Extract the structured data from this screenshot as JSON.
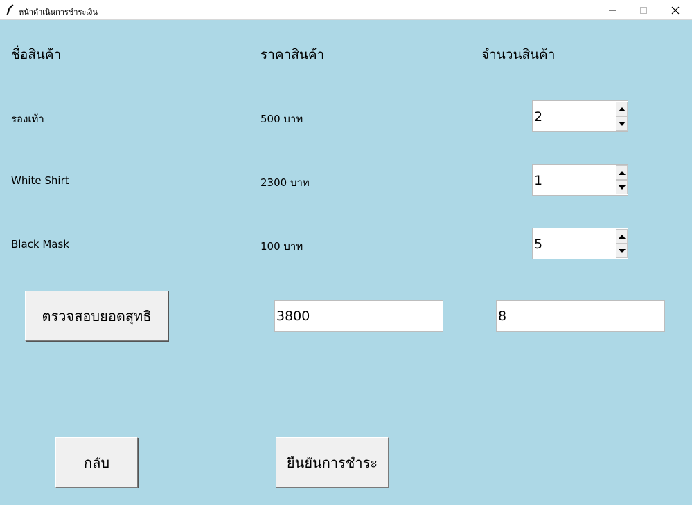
{
  "window": {
    "title": "หน้าดำเนินการชำระเงิน",
    "icon": "feather-icon"
  },
  "headers": {
    "name": "ชื่อสินค้า",
    "price": "ราคาสินค้า",
    "quantity": "จำนวนสินค้า"
  },
  "products": [
    {
      "name": "รองเท้า",
      "price": "500 บาท",
      "quantity": "2"
    },
    {
      "name": "White Shirt",
      "price": "2300 บาท",
      "quantity": "1"
    },
    {
      "name": "Black Mask",
      "price": "100 บาท",
      "quantity": "5"
    }
  ],
  "summary": {
    "check_button": "ตรวจสอบยอดสุทธิ",
    "total_price": "3800",
    "total_quantity": "8"
  },
  "actions": {
    "back_button": "กลับ",
    "confirm_button": "ยืนยันการชำระ"
  },
  "colors": {
    "background": "#add8e6",
    "button": "#f0f0f0"
  }
}
